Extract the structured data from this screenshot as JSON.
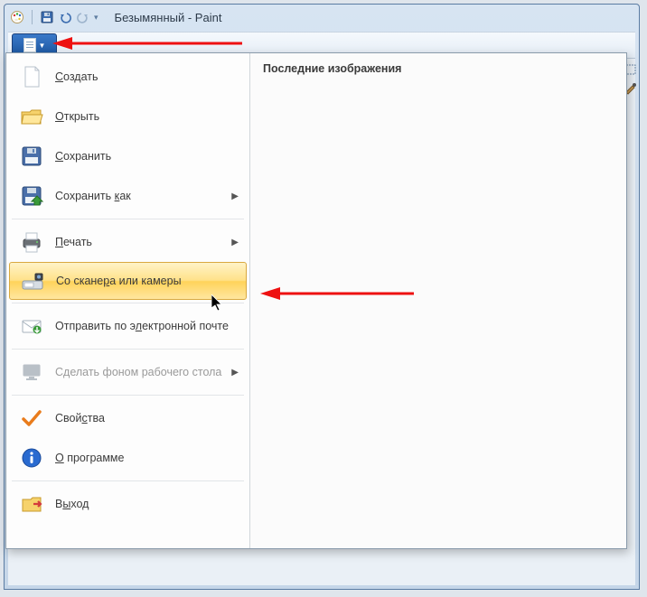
{
  "window": {
    "title": "Безымянный - Paint"
  },
  "menu": {
    "items": [
      {
        "key": "new",
        "label": "Создать",
        "underline": 0,
        "icon": "new-file",
        "disabled": false,
        "submenu": false
      },
      {
        "key": "open",
        "label": "Открыть",
        "underline": 0,
        "icon": "folder-open",
        "disabled": false,
        "submenu": false
      },
      {
        "key": "save",
        "label": "Сохранить",
        "underline": 0,
        "icon": "floppy",
        "disabled": false,
        "submenu": false
      },
      {
        "key": "saveas",
        "label": "Сохранить как",
        "underline": 10,
        "icon": "floppy-as",
        "disabled": false,
        "submenu": true
      },
      {
        "key": "print",
        "label": "Печать",
        "underline": 0,
        "icon": "printer",
        "disabled": false,
        "submenu": true
      },
      {
        "key": "scanner",
        "label": "Со сканера или камеры",
        "underline": 8,
        "icon": "scanner",
        "disabled": false,
        "submenu": false,
        "hovered": true
      },
      {
        "key": "send",
        "label": "Отправить по электронной почте",
        "underline": 14,
        "icon": "mail",
        "disabled": false,
        "submenu": false
      },
      {
        "key": "wallpaper",
        "label": "Сделать фоном рабочего стола",
        "underline": -1,
        "icon": "desktop",
        "disabled": true,
        "submenu": true
      },
      {
        "key": "props",
        "label": "Свойства",
        "underline": 4,
        "icon": "check",
        "disabled": false,
        "submenu": false
      },
      {
        "key": "about",
        "label": "О программе",
        "underline": 0,
        "icon": "info",
        "disabled": false,
        "submenu": false
      },
      {
        "key": "exit",
        "label": "Выход",
        "underline": 1,
        "icon": "exit",
        "disabled": false,
        "submenu": false
      }
    ]
  },
  "recent": {
    "title": "Последние изображения"
  }
}
